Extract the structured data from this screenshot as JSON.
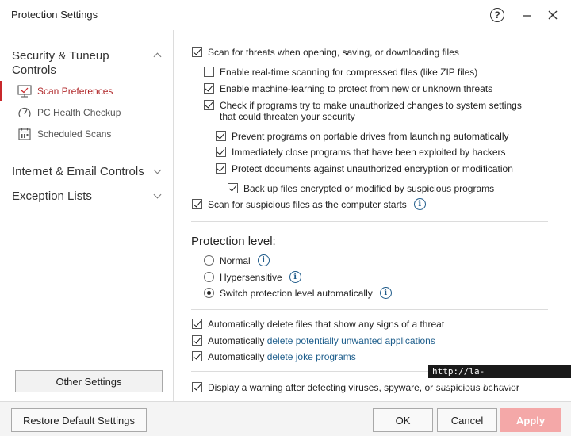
{
  "window": {
    "title": "Protection Settings"
  },
  "sidebar": {
    "group1": "Security & Tuneup Controls",
    "items": [
      {
        "label": "Scan Preferences",
        "icon": "monitor-check-icon",
        "active": true
      },
      {
        "label": "PC Health Checkup",
        "icon": "gauge-icon",
        "active": false
      },
      {
        "label": "Scheduled Scans",
        "icon": "calendar-icon",
        "active": false
      }
    ],
    "group2": "Internet & Email Controls",
    "group3": "Exception Lists",
    "other_settings": "Other Settings"
  },
  "options": {
    "scan_on_access": "Scan for threats when opening, saving, or downloading files",
    "compressed": "Enable real-time scanning for compressed files (like ZIP files)",
    "machine_learning": "Enable machine-learning to protect from new or unknown threats",
    "unauthorized_changes": "Check if programs try to make unauthorized changes to system settings that could threaten your security",
    "portable_drives": "Prevent programs on portable drives from launching automatically",
    "close_exploited": "Immediately close programs that have been exploited by hackers",
    "protect_documents": "Protect documents against unauthorized encryption or modification",
    "backup_files": "Back up files encrypted or modified by suspicious programs",
    "startup_scan": "Scan for suspicious files as the computer starts"
  },
  "protection_level": {
    "title": "Protection level:",
    "normal": "Normal",
    "hypersensitive": "Hypersensitive",
    "auto": "Switch protection level automatically"
  },
  "auto_delete": {
    "threats": "Automatically delete files that show any signs of a threat",
    "pua_prefix": "Automatically ",
    "pua_link": "delete potentially unwanted applications",
    "joke_prefix": "Automatically ",
    "joke_link": "delete joke programs",
    "warning": "Display a warning after detecting viruses, spyware, or suspicious behavior"
  },
  "footer": {
    "restore": "Restore Default Settings",
    "ok": "OK",
    "cancel": "Cancel",
    "apply": "Apply"
  },
  "watermark": "http://la-nube.tistory.com",
  "colors": {
    "accent": "#c8282b",
    "link": "#1e5e8c",
    "apply_disabled": "#f4a8a8"
  }
}
